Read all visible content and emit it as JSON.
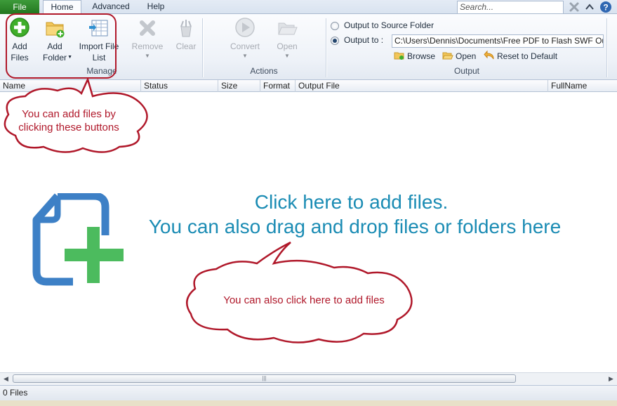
{
  "tabs": {
    "file": "File",
    "items": [
      "Home",
      "Advanced",
      "Help"
    ],
    "active": "Home"
  },
  "search": {
    "placeholder": "Search..."
  },
  "title_icons": [
    "close-icon",
    "collapse-ribbon-icon",
    "help-icon"
  ],
  "ribbon": {
    "manage": {
      "label": "Manage",
      "add_files": [
        "Add",
        "Files"
      ],
      "add_folder": [
        "Add",
        "Folder"
      ],
      "import_file_list": [
        "Import File",
        "List"
      ]
    },
    "edit": {
      "remove": "Remove",
      "clear": "Clear"
    },
    "actions": {
      "label": "Actions",
      "convert": "Convert",
      "open": "Open"
    },
    "output": {
      "label": "Output",
      "source_folder": "Output to Source Folder",
      "output_to": "Output to :",
      "path": "C:\\Users\\Dennis\\Documents\\Free PDF to Flash SWF Outp",
      "selected": "output_to",
      "browse": "Browse",
      "open": "Open",
      "reset": "Reset to Default"
    }
  },
  "columns": [
    "Name",
    "Status",
    "Size",
    "Format",
    "Output File",
    "FullName"
  ],
  "main": {
    "line1": "Click here to add files.",
    "line2": "You can also drag and drop files or folders here"
  },
  "callouts": {
    "buttons_hint": [
      "You can add files by",
      "clicking these buttons"
    ],
    "click_hint": "You can also click here to add files"
  },
  "colors": {
    "accent_green": "#23761f",
    "main_text": "#1b8cb4",
    "callout_red": "#b0182a",
    "add_icon_blue": "#3d80c6",
    "add_icon_green": "#4cbb5e"
  },
  "status": {
    "files": "0 Files"
  }
}
